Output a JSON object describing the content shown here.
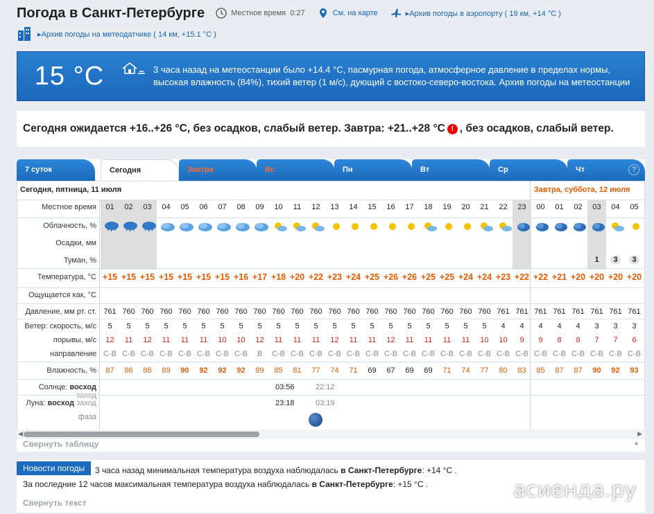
{
  "header": {
    "title": "Погода в Санкт-Петербурге",
    "local_time_label": "Местное время",
    "local_time": "0:27",
    "map_link": "См. на карте",
    "airport_link": "Архив погоды в аэропорту ( 19 км, +14 °C )",
    "station_link": "Архив погоды на метеодатчике ( 14 км, +15.1 °C )"
  },
  "now": {
    "temp": "15 °C",
    "text": "3 часа назад на метеостанции было +14.4 °C, пасмурная погода, атмосферное давление в пределах нормы, высокая влажность (84%), тихий ветер (1 м/с), дующий с востоко-северо-востока. Архив погоды на метеостанции"
  },
  "forecast": {
    "part1": "Сегодня ожидается +16..+26 °C, без осадков, слабый ветер. Завтра: +21..+28 °C",
    "warn": "!",
    "part2": ", без осадков, слабый ветер."
  },
  "tabs": [
    "7 суток",
    "Сегодня",
    "Завтра",
    "Вс",
    "Пн",
    "Вт",
    "Ср",
    "Чт"
  ],
  "help": "?",
  "day_today": "Сегодня, пятница, 11 июля",
  "day_tomorrow": "Завтра, суббота, 12 июля",
  "labels": {
    "time": "Местное время",
    "clouds": "Облачность, %",
    "precip": "Осадки, мм",
    "fog": "Туман, %",
    "temp": "Температура, °C",
    "feels": "Ощущается как, °C",
    "pressure": "Давление, мм рт. ст.",
    "wind": "Ветер: скорость, м/с",
    "gusts": "порывы, м/с",
    "direction": "направление",
    "humidity": "Влажность, %",
    "sun": "Солнце:",
    "sun_rise": "восход",
    "sun_set": "заход",
    "moon": "Луна:",
    "moon_rise": "восход",
    "moon_set": "заход",
    "phase": "фаза"
  },
  "hours": [
    "01",
    "02",
    "03",
    "04",
    "05",
    "06",
    "07",
    "08",
    "09",
    "10",
    "11",
    "12",
    "13",
    "14",
    "15",
    "16",
    "17",
    "18",
    "19",
    "20",
    "21",
    "22",
    "23",
    "00",
    "01",
    "02",
    "03",
    "04",
    "05"
  ],
  "cloud_icons": [
    "cloud-rain",
    "cloud-rain",
    "cloud-rain",
    "cloud",
    "cloud",
    "cloud",
    "cloud",
    "cloud",
    "cloud",
    "cloud-sun",
    "sun-cloud",
    "sun-cloud",
    "sun",
    "sun",
    "sun",
    "sun",
    "sun",
    "sun-cloud",
    "sun",
    "sun",
    "sun-cloud",
    "sun-cloud",
    "cloud-night",
    "cloud-night",
    "cloud-night",
    "cloud-night",
    "cloud-night",
    "sun-cloud",
    "sun"
  ],
  "fog": [
    "",
    "",
    "",
    "",
    "",
    "",
    "",
    "",
    "",
    "",
    "",
    "",
    "",
    "",
    "",
    "",
    "",
    "",
    "",
    "",
    "",
    "",
    "",
    "",
    "",
    "",
    "1",
    "3",
    "3"
  ],
  "temps": [
    "+15",
    "+15",
    "+15",
    "+15",
    "+15",
    "+15",
    "+15",
    "+16",
    "+17",
    "+18",
    "+20",
    "+22",
    "+23",
    "+24",
    "+25",
    "+26",
    "+26",
    "+25",
    "+25",
    "+24",
    "+24",
    "+23",
    "+22",
    "+22",
    "+21",
    "+20",
    "+20",
    "+20",
    "+20"
  ],
  "pressure": [
    "761",
    "760",
    "760",
    "760",
    "760",
    "760",
    "760",
    "760",
    "760",
    "760",
    "760",
    "760",
    "760",
    "760",
    "760",
    "760",
    "760",
    "760",
    "760",
    "760",
    "760",
    "761",
    "761",
    "761",
    "761",
    "761",
    "761",
    "761",
    "761"
  ],
  "wind": [
    "5",
    "5",
    "5",
    "5",
    "5",
    "5",
    "5",
    "5",
    "5",
    "5",
    "5",
    "5",
    "5",
    "5",
    "5",
    "5",
    "5",
    "5",
    "5",
    "5",
    "5",
    "4",
    "4",
    "4",
    "4",
    "4",
    "3",
    "3",
    "3"
  ],
  "gusts": [
    "12",
    "11",
    "12",
    "11",
    "11",
    "11",
    "10",
    "10",
    "12",
    "11",
    "11",
    "11",
    "12",
    "11",
    "11",
    "12",
    "11",
    "11",
    "11",
    "11",
    "10",
    "10",
    "9",
    "9",
    "8",
    "8",
    "7",
    "7",
    "6"
  ],
  "direction": [
    "С-В",
    "С-В",
    "С-В",
    "С-В",
    "С-В",
    "С-В",
    "С-В",
    "С-В",
    "В",
    "С-В",
    "С-В",
    "С-В",
    "С-В",
    "С-В",
    "С-В",
    "С-В",
    "С-В",
    "С-В",
    "С-В",
    "С-В",
    "С-В",
    "С-В",
    "С-В",
    "С-В",
    "С-В",
    "С-В",
    "С-В",
    "С-В",
    "С-В"
  ],
  "humidity": [
    "87",
    "86",
    "86",
    "89",
    "90",
    "92",
    "92",
    "92",
    "89",
    "85",
    "81",
    "77",
    "74",
    "71",
    "69",
    "67",
    "69",
    "69",
    "71",
    "74",
    "77",
    "80",
    "83",
    "85",
    "87",
    "87",
    "90",
    "92",
    "93"
  ],
  "sun_rise": "03:56",
  "sun_set": "22:12",
  "moon_rise": "23:18",
  "moon_set": "03:19",
  "collapse_table": "Свернуть таблицу",
  "news": {
    "badge": "Новости погоды",
    "line1_a": "3 часа назад минимальная температура воздуха наблюдалась",
    "line1_b": "в Санкт-Петербурге",
    "line1_c": ": +14 °C .",
    "line2_a": "За последние 12 часов максимальная температура воздуха наблюдалась",
    "line2_b": "в Санкт-Петербурге",
    "line2_c": ": +15 °C .",
    "collapse": "Свернуть текст"
  },
  "watermark": "асиенда.ру",
  "colors": {
    "accent": "#1a6bbd",
    "temp": "#e85a00",
    "gusts": "#d62020",
    "humidity_high": "#e85a00"
  }
}
